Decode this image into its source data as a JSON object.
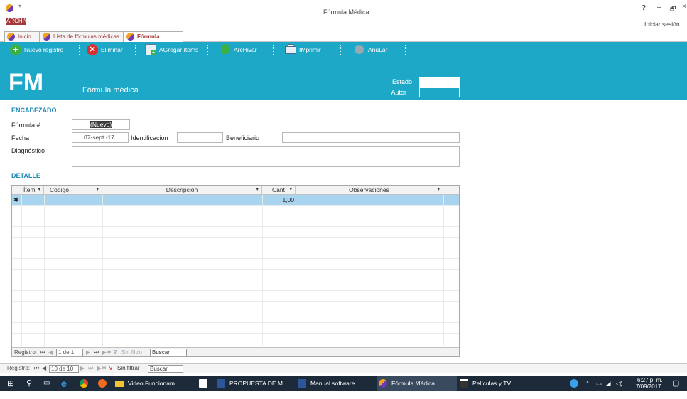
{
  "window": {
    "title": "Fórmula Médica",
    "help": "?",
    "minimize": "–",
    "restore": "🗗",
    "close": "×",
    "signin": "Iniciar sesión"
  },
  "ribbon": {
    "file": "ARCHIVO"
  },
  "tabs": [
    {
      "label": "Inicio"
    },
    {
      "label": "Lista de fórmulas médicas"
    },
    {
      "label": "Fórmula médica"
    }
  ],
  "toolbar": {
    "nuevo": {
      "pre": "",
      "u": "N",
      "post": "uevo registro"
    },
    "eliminar": {
      "pre": "",
      "u": "E",
      "post": "liminar"
    },
    "agregar": {
      "pre": "A",
      "u": "G",
      "post": "regar ítems"
    },
    "archivar": {
      "pre": "Arc",
      "u": "H",
      "post": "ivar"
    },
    "imprimir": {
      "pre": "",
      "u": "IM",
      "post": "primir"
    },
    "anular": {
      "pre": "Anu",
      "u": "L",
      "post": "ar"
    }
  },
  "header": {
    "code": "FM",
    "subtitle": "Fórmula médica",
    "estado_label": "Estado",
    "autor_label": "Autor",
    "estado_value": "",
    "autor_value": ""
  },
  "encabezado": {
    "title": "ENCABEZADO",
    "formula_label": "Fórmula #",
    "formula_value": "(Nuevo)",
    "fecha_label": "Fecha",
    "fecha_value": "07-sept.-17",
    "identificacion_label": "Identificacion",
    "identificacion_value": "",
    "beneficiario_label": "Beneficiario",
    "beneficiario_value": "",
    "diagnostico_label": "Diagnóstico",
    "diagnostico_value": ""
  },
  "detalle": {
    "title": "DETALLE",
    "columns": [
      "Ítem",
      "Código",
      "Descripción",
      "Cant",
      "Observaciones"
    ],
    "new_row": {
      "marker": "✱",
      "cant": "1,00"
    },
    "nav": {
      "label": "Registro:",
      "pos": "1 de 1",
      "filter": "Sin filtro",
      "search": "Buscar"
    }
  },
  "form_nav": {
    "label": "Registro:",
    "pos": "10 de 10",
    "filter": "Sin filtrar",
    "search": "Buscar"
  },
  "taskbar": {
    "apps": [
      "Video Funcionam...",
      "PROPUESTA DE M...",
      "Manual software ...",
      "Fórmula Médica",
      "Películas y TV"
    ],
    "time": "6:27 p. m.",
    "date": "7/09/2017"
  }
}
